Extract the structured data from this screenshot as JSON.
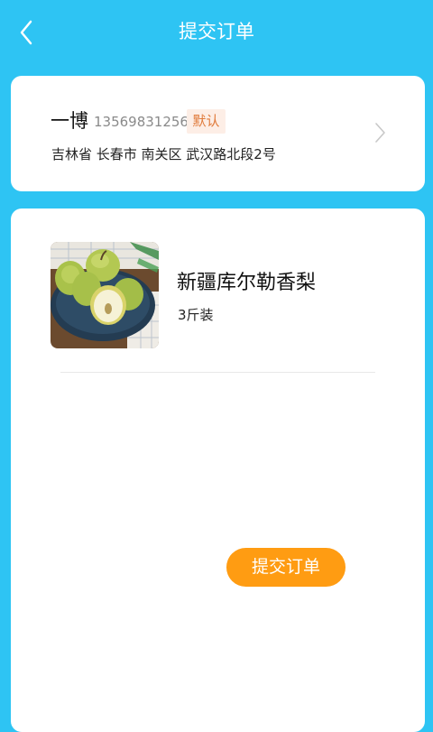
{
  "header": {
    "title": "提交订单",
    "back_icon": "chevron-left-icon"
  },
  "address": {
    "name": "一博",
    "phone": "13569831256",
    "badge": "默认",
    "full_address": "吉林省 长春市 南关区 武汉路北段2号",
    "chevron_icon": "chevron-right-icon"
  },
  "product": {
    "name": "新疆库尔勒香梨",
    "spec": "3斤装",
    "image": "pear-product-image"
  },
  "actions": {
    "submit_label": "提交订单"
  },
  "colors": {
    "background": "#2ec4f3",
    "accent": "#ff9c12",
    "badge_bg": "#fdeee6",
    "badge_text": "#e07a3a"
  }
}
